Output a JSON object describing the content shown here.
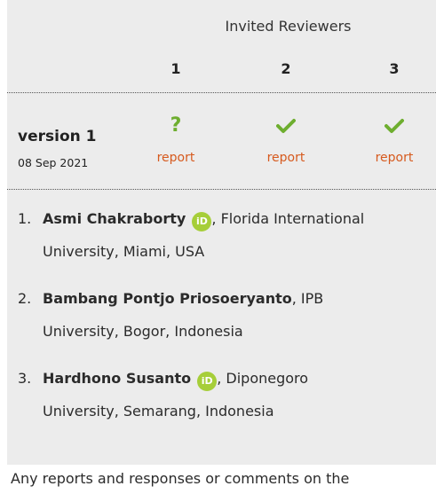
{
  "header": {
    "title": "Invited Reviewers"
  },
  "columns": [
    "1",
    "2",
    "3"
  ],
  "version": {
    "label": "version 1",
    "date": "08 Sep 2021"
  },
  "statuses": [
    {
      "icon": "question-icon",
      "report": "report"
    },
    {
      "icon": "check-icon",
      "report": "report"
    },
    {
      "icon": "check-icon",
      "report": "report"
    }
  ],
  "reviewers": [
    {
      "num": "1.",
      "name": "Asmi Chakraborty",
      "orcid": "iD",
      "affiliation_line1": ", Florida International",
      "affiliation_line2": "University, Miami, USA"
    },
    {
      "num": "2.",
      "name": "Bambang Pontjo Priosoeryanto",
      "affiliation_line1": ", IPB",
      "affiliation_line2": "University, Bogor, Indonesia"
    },
    {
      "num": "3.",
      "name": "Hardhono Susanto",
      "orcid": "iD",
      "affiliation_line1": ", Diponegoro",
      "affiliation_line2": "University, Semarang, Indonesia"
    }
  ],
  "footer": {
    "text": "Any reports and responses or comments on the"
  },
  "colors": {
    "panel_bg": "#ececec",
    "accent_green": "#6eae2f",
    "report_orange": "#d65a1e",
    "orcid_green": "#a6ce39"
  }
}
